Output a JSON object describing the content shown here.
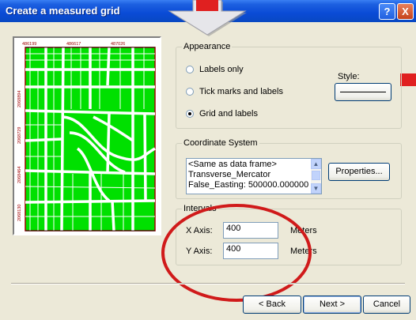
{
  "window": {
    "title": "Create a measured grid"
  },
  "titlebar": {
    "help_glyph": "?",
    "close_glyph": "X"
  },
  "preview": {
    "x_ticks": [
      "486199",
      "486617",
      "487026"
    ],
    "y_ticks": [
      "2068894",
      "2068729",
      "2068464",
      "2068130"
    ],
    "colors": {
      "fill": "#00e000",
      "border": "#a00000"
    }
  },
  "appearance": {
    "title": "Appearance",
    "options": [
      {
        "label": "Labels only",
        "selected": false
      },
      {
        "label": "Tick marks and labels",
        "selected": false
      },
      {
        "label": "Grid and labels",
        "selected": true
      }
    ],
    "style_label": "Style:"
  },
  "coordinate_system": {
    "title": "Coordinate System",
    "lines": [
      "<Same as data frame>",
      "Transverse_Mercator",
      "False_Easting: 500000.000000"
    ],
    "properties_button": "Properties..."
  },
  "intervals": {
    "title": "Intervals",
    "x_label": "X Axis:",
    "x_value": "400",
    "x_unit": "Meters",
    "y_label": "Y Axis:",
    "y_value": "400",
    "y_unit": "Meters"
  },
  "footer": {
    "back": "< Back",
    "next": "Next >",
    "cancel": "Cancel"
  },
  "annotation_colors": {
    "oval": "#d01a1a",
    "arrow": "#e02020"
  }
}
